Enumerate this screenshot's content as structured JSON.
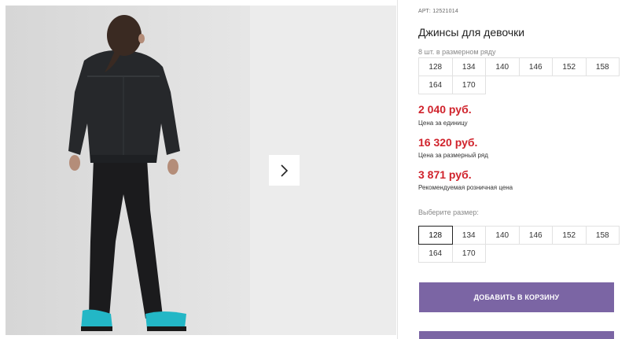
{
  "product": {
    "sku": "АРТ: 12521014",
    "title": "Джинсы для девочки",
    "size_row_hint": "8 шт. в размерном ряду",
    "size_row": [
      "128",
      "134",
      "140",
      "146",
      "152",
      "158",
      "164",
      "170"
    ]
  },
  "prices": {
    "unit_price": "2 040 руб.",
    "unit_label": "Цена за единицу",
    "row_price": "16 320 руб.",
    "row_label": "Цена за размерный ряд",
    "retail_price": "3 871 руб.",
    "retail_label": "Рекомендуемая розничная цена"
  },
  "size_select": {
    "label": "Выберите размер:",
    "options": [
      "128",
      "134",
      "140",
      "146",
      "152",
      "158",
      "164",
      "170"
    ],
    "selected": "128"
  },
  "actions": {
    "add_to_cart": "ДОБАВИТЬ В КОРЗИНУ"
  },
  "colors": {
    "price_red": "#d0232c",
    "button_purple": "#7b65a4"
  },
  "icons": {
    "gallery_next": "chevron-right-icon"
  }
}
